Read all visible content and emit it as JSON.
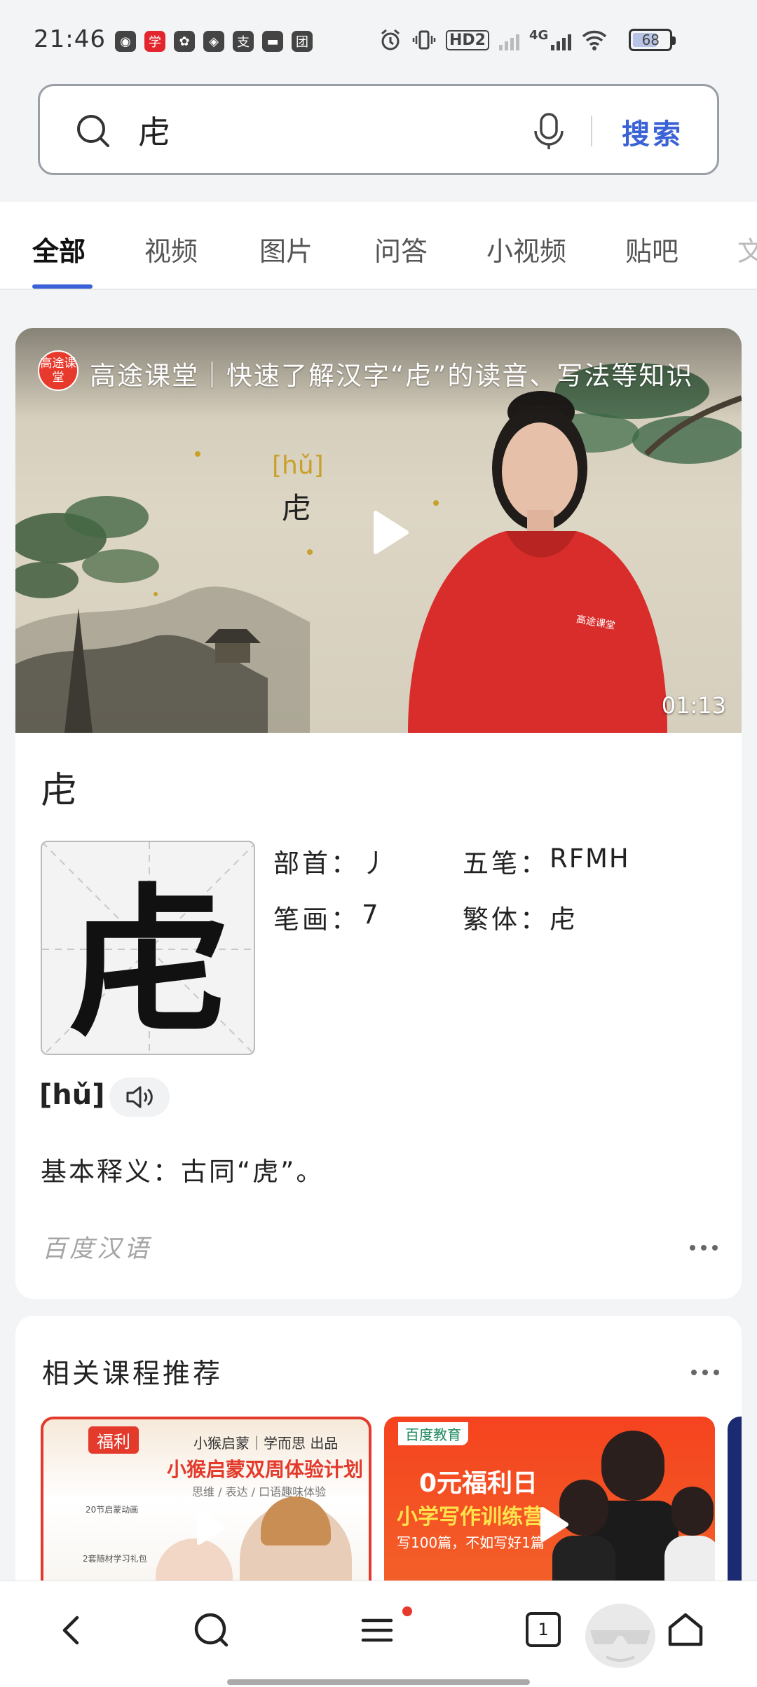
{
  "status_bar": {
    "time": "21:46",
    "app_icons": [
      "chat-bubble-icon",
      "xuexi-app-icon",
      "photo-app-icon",
      "sound-app-icon",
      "alipay-icon",
      "message-app-icon",
      "meituan-icon"
    ],
    "app_glyphs": [
      "◉",
      "学",
      "✿",
      "◈",
      "支",
      "▬",
      "团"
    ],
    "network_hd": "HD2",
    "network_type": "4G",
    "battery": "68",
    "battery_level": 0.68
  },
  "search": {
    "query": "虍",
    "button_label": "搜索"
  },
  "tabs": [
    "全部",
    "视频",
    "图片",
    "问答",
    "小视频",
    "贴吧",
    "文"
  ],
  "video": {
    "logo_text": "高途课堂",
    "title": "高途课堂｜快速了解汉字“虍”的读音、写法等知识",
    "pinyin": "[hǔ]",
    "char": "虍",
    "duration": "01:13",
    "shirt_text": "高途课堂"
  },
  "character": {
    "heading": "虍",
    "big": "虍",
    "radical_label": "部首：",
    "radical_value": "丿",
    "wubi_label": "五笔：",
    "wubi_value": "RFMH",
    "strokes_label": "笔画：",
    "strokes_value": "7",
    "traditional_label": "繁体：",
    "traditional_value": "虍",
    "pinyin": "[hǔ]",
    "definition": "基本释义：古同“虎”。",
    "source": "百度汉语"
  },
  "courses": {
    "title": "相关课程推荐",
    "card1": {
      "badge": "福利",
      "brand": "小猴启蒙｜学而思 出品",
      "headline": "小猴启蒙双周体验计划",
      "sub": "思维 / 表达 / 口语趣味体验",
      "side1": "20节启蒙动画",
      "side2": "2套随材学习礼包"
    },
    "card2": {
      "brand": "百度教育",
      "line1": "0元福利日",
      "line2": "小学写作训练营",
      "line3": "写100篇，不如写好1篇"
    }
  },
  "bottom_nav": {
    "tab_count": "1"
  }
}
